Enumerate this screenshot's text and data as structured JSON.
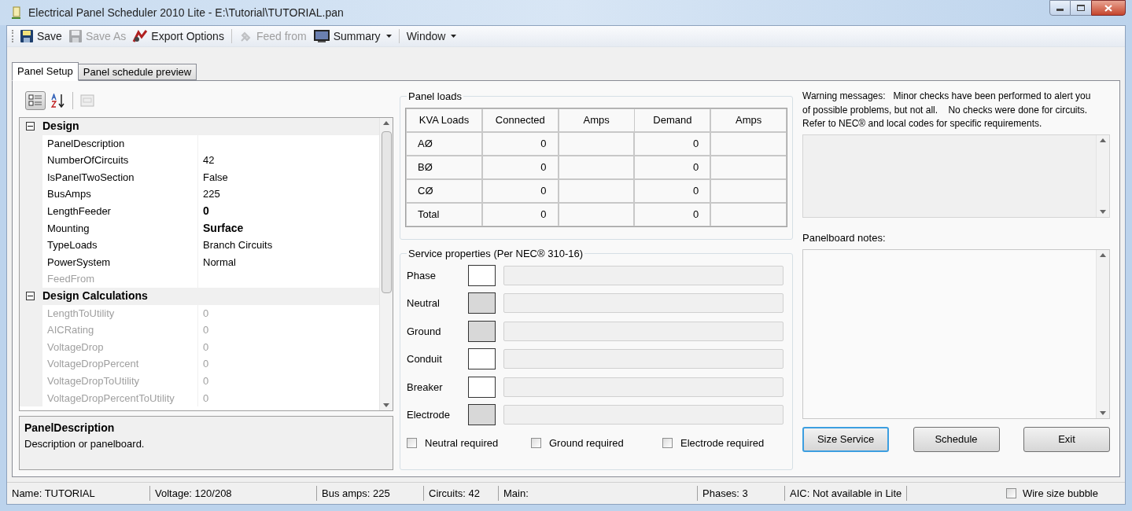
{
  "window": {
    "title": "Electrical Panel Scheduler 2010 Lite - E:\\Tutorial\\TUTORIAL.pan"
  },
  "toolbar": [
    {
      "kind": "button",
      "label": "Save",
      "disabled": false,
      "dropdown": false
    },
    {
      "kind": "button",
      "label": "Save As",
      "disabled": true,
      "dropdown": false
    },
    {
      "kind": "button",
      "label": "Export Options",
      "disabled": false,
      "dropdown": false
    },
    {
      "kind": "separator"
    },
    {
      "kind": "button",
      "label": "Feed from",
      "disabled": true,
      "dropdown": false
    },
    {
      "kind": "button",
      "label": "Summary",
      "disabled": false,
      "dropdown": true
    },
    {
      "kind": "separator"
    },
    {
      "kind": "button",
      "label": "Window",
      "disabled": false,
      "dropdown": true
    }
  ],
  "tabs": [
    {
      "label": "Panel Setup",
      "selected": true
    },
    {
      "label": "Panel schedule preview",
      "selected": false
    }
  ],
  "property_grid": {
    "categories": [
      {
        "name": "Design",
        "expanded": true,
        "properties": [
          {
            "name": "PanelDescription",
            "disabled": false
          },
          {
            "name": "NumberOfCircuits",
            "value": "42",
            "disabled": false,
            "modified": false
          },
          {
            "name": "IsPanelTwoSection",
            "value": "False",
            "disabled": false,
            "modified": false
          },
          {
            "name": "BusAmps",
            "value": "225",
            "disabled": false,
            "modified": false
          },
          {
            "name": "LengthFeeder",
            "value": "0",
            "disabled": false,
            "modified": true
          },
          {
            "name": "Mounting",
            "value": "Surface",
            "disabled": false,
            "modified": true
          },
          {
            "name": "TypeLoads",
            "value": "Branch Circuits",
            "disabled": false,
            "modified": false
          },
          {
            "name": "PowerSystem",
            "value": "Normal",
            "disabled": false,
            "modified": false
          },
          {
            "name": "FeedFrom",
            "disabled": true
          }
        ]
      },
      {
        "name": "Design Calculations",
        "expanded": true,
        "properties": [
          {
            "name": "LengthToUtility",
            "value": "0",
            "disabled": true,
            "modified": false
          },
          {
            "name": "AICRating",
            "value": "0",
            "disabled": true,
            "modified": false
          },
          {
            "name": "VoltageDrop",
            "value": "0",
            "disabled": true,
            "modified": false
          },
          {
            "name": "VoltageDropPercent",
            "value": "0",
            "disabled": true,
            "modified": false
          },
          {
            "name": "VoltageDropToUtility",
            "value": "0",
            "disabled": true,
            "modified": false
          },
          {
            "name": "VoltageDropPercentToUtility",
            "value": "0",
            "disabled": true,
            "modified": false
          }
        ]
      }
    ],
    "description": {
      "title": "PanelDescription",
      "text": "Description or panelboard."
    }
  },
  "panel_loads": {
    "title": "Panel loads",
    "columns": [
      "KVA Loads",
      "Connected",
      "Amps",
      "Demand",
      "Amps"
    ],
    "rows": [
      [
        "AØ",
        "0",
        "",
        "0",
        ""
      ],
      [
        "BØ",
        "0",
        "",
        "0",
        ""
      ],
      [
        "CØ",
        "0",
        "",
        "0",
        ""
      ],
      [
        "Total",
        "0",
        "",
        "0",
        ""
      ]
    ]
  },
  "service_properties": {
    "title": "Service properties (Per NEC® 310-16)",
    "rows": [
      {
        "label": "Phase",
        "enabled": true
      },
      {
        "label": "Neutral",
        "enabled": false
      },
      {
        "label": "Ground",
        "enabled": false
      },
      {
        "label": "Conduit",
        "enabled": true
      },
      {
        "label": "Breaker",
        "enabled": true
      },
      {
        "label": "Electrode",
        "enabled": false
      }
    ],
    "checkboxes": [
      {
        "label": "Neutral required",
        "checked": false
      },
      {
        "label": "Ground required",
        "checked": false
      },
      {
        "label": "Electrode required",
        "checked": false
      }
    ]
  },
  "warning": {
    "text": "Warning messages:   Minor checks have been performed to alert you of possible problems, but not all.    No checks were done for circuits.  Refer to NEC® and local codes for specific requirements."
  },
  "notes": {
    "label": "Panelboard notes:"
  },
  "buttons": [
    {
      "label": "Size Service",
      "focused": true
    },
    {
      "label": "Schedule",
      "focused": false
    },
    {
      "label": "Exit",
      "focused": false
    }
  ],
  "status_bar": {
    "items": [
      "Name:  TUTORIAL",
      "Voltage: 120/208",
      "Bus amps: 225",
      "Circuits: 42",
      "Main:",
      "Phases: 3",
      "AIC:  Not available in Lite"
    ],
    "checkbox": {
      "label": "Wire size bubble",
      "checked": false
    }
  }
}
